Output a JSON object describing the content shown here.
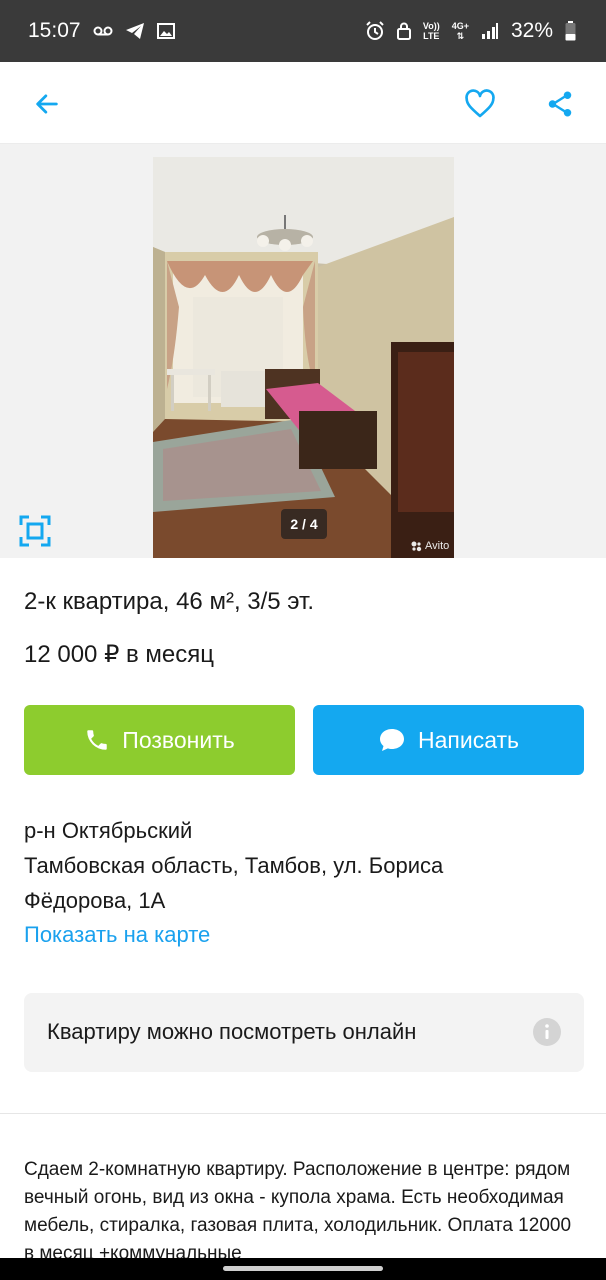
{
  "status_bar": {
    "time": "15:07",
    "network_top": "4G+",
    "volte_top": "Vo))",
    "volte_bottom": "LTE",
    "battery": "32%"
  },
  "colors": {
    "accent_blue": "#14a8f0",
    "call_green": "#8dcc2e",
    "link_blue": "#1aa1ee"
  },
  "header": {
    "back_icon": "arrow-left-icon",
    "favorite_icon": "heart-icon",
    "share_icon": "share-icon"
  },
  "gallery": {
    "counter": "2 / 4",
    "watermark": "Avito"
  },
  "listing": {
    "title": "2-к квартира, 46 м², 3/5 эт.",
    "price": "12 000 ₽ в месяц"
  },
  "actions": {
    "call_label": "Позвонить",
    "write_label": "Написать"
  },
  "address": {
    "district": "р-н Октябрьский",
    "line1": "Тамбовская область, Тамбов, ул. Бориса",
    "line2": "Фёдорова, 1А",
    "map_link": "Показать на карте"
  },
  "online_view": {
    "text": "Квартиру можно посмотреть онлайн"
  },
  "description": "Сдаем 2-комнатную квартиру. Расположение в центре: рядом вечный огонь, вид из окна - купола храма. Есть необходимая мебель, стиралка, газовая плита, холодильник. Оплата 12000 в месяц +коммунальные"
}
